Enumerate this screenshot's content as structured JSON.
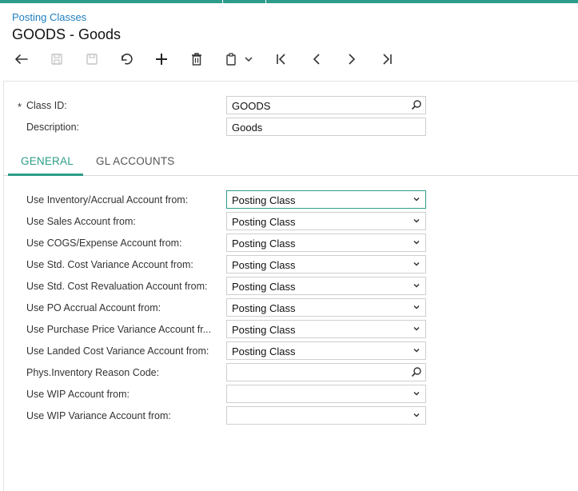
{
  "app": {
    "breadcrumb": "Posting Classes",
    "title": "GOODS - Goods",
    "accent_color": "#2d9c8a",
    "link_color": "#1f7fc0"
  },
  "toolbar": {
    "buttons": [
      {
        "name": "back-icon",
        "enabled": true
      },
      {
        "name": "save-close-icon",
        "enabled": false
      },
      {
        "name": "save-icon",
        "enabled": false
      },
      {
        "name": "undo-icon",
        "enabled": true
      },
      {
        "name": "add-icon",
        "enabled": true
      },
      {
        "name": "delete-icon",
        "enabled": true
      },
      {
        "name": "copy-paste-icon",
        "enabled": true
      },
      {
        "name": "chevron-down-icon",
        "enabled": true
      },
      {
        "name": "first-record-icon",
        "enabled": true
      },
      {
        "name": "previous-record-icon",
        "enabled": true
      },
      {
        "name": "next-record-icon",
        "enabled": true
      },
      {
        "name": "last-record-icon",
        "enabled": true
      }
    ]
  },
  "header_form": {
    "class_id_label": "Class ID:",
    "class_id_value": "GOODS",
    "required_marker": "*",
    "description_label": "Description:",
    "description_value": "Goods"
  },
  "tabs": [
    {
      "label": "GENERAL",
      "active": true
    },
    {
      "label": "GL ACCOUNTS",
      "active": false
    }
  ],
  "general": {
    "rows": [
      {
        "label": "Use Inventory/Accrual Account from:",
        "value": "Posting Class",
        "type": "select"
      },
      {
        "label": "Use Sales Account from:",
        "value": "Posting Class",
        "type": "select"
      },
      {
        "label": "Use COGS/Expense Account from:",
        "value": "Posting Class",
        "type": "select"
      },
      {
        "label": "Use Std. Cost Variance Account from:",
        "value": "Posting Class",
        "type": "select"
      },
      {
        "label": "Use Std. Cost Revaluation Account from:",
        "value": "Posting Class",
        "type": "select"
      },
      {
        "label": "Use PO Accrual Account from:",
        "value": "Posting Class",
        "type": "select"
      },
      {
        "label": "Use Purchase Price Variance Account fr...",
        "value": "Posting Class",
        "type": "select"
      },
      {
        "label": "Use Landed Cost Variance Account from:",
        "value": "Posting Class",
        "type": "select"
      },
      {
        "label": "Phys.Inventory Reason Code:",
        "value": "",
        "type": "lookup"
      },
      {
        "label": "Use WIP Account from:",
        "value": "",
        "type": "select"
      },
      {
        "label": "Use WIP Variance Account from:",
        "value": "",
        "type": "select"
      }
    ]
  }
}
